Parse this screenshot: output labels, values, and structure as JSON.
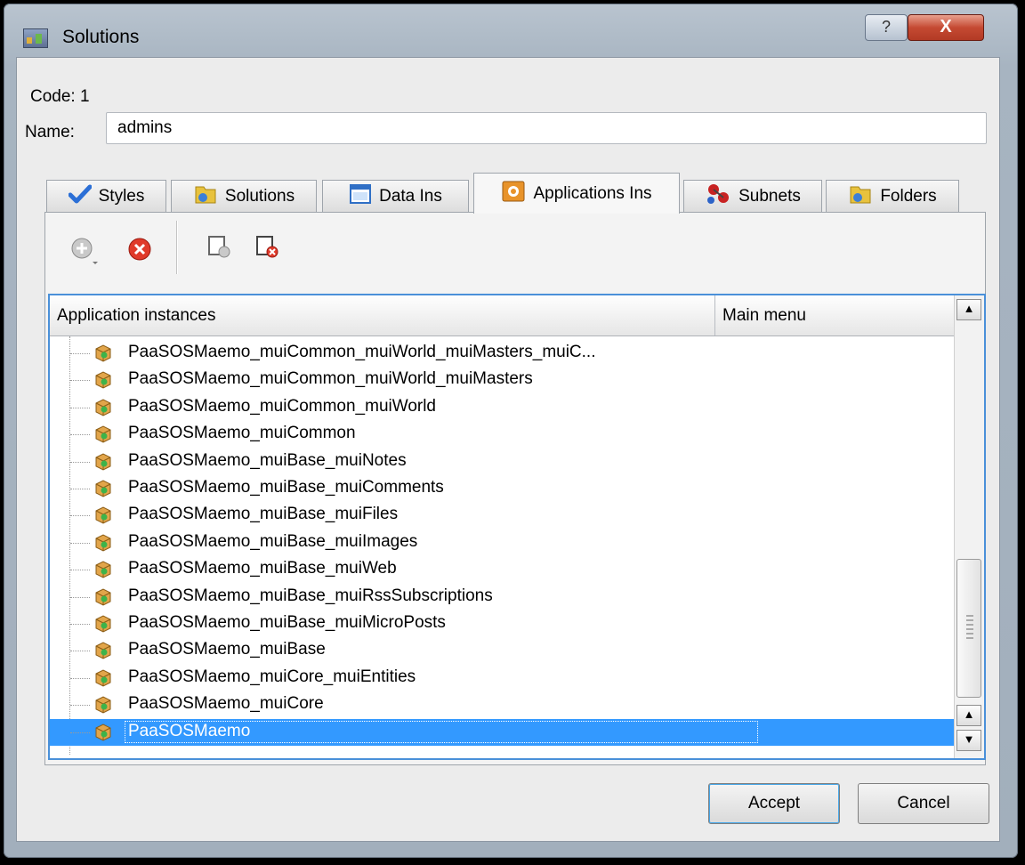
{
  "window": {
    "title": "Solutions"
  },
  "title_buttons": {
    "help": "?",
    "close": "X"
  },
  "form": {
    "code_label": "Code:",
    "code_value": "1",
    "name_label": "Name:",
    "name_value": "admins"
  },
  "tabs": [
    {
      "label": "Styles",
      "icon": "checkmark-icon"
    },
    {
      "label": "Solutions",
      "icon": "solutions-icon"
    },
    {
      "label": "Data Ins",
      "icon": "window-icon"
    },
    {
      "label": "Applications Ins",
      "icon": "gear-icon",
      "active": true
    },
    {
      "label": "Subnets",
      "icon": "molecule-icon"
    },
    {
      "label": "Folders",
      "icon": "folders-icon"
    }
  ],
  "toolbar": [
    {
      "icon": "add-icon"
    },
    {
      "icon": "delete-icon"
    },
    {
      "icon": "assign-icon"
    },
    {
      "icon": "unassign-icon"
    }
  ],
  "tree": {
    "columns": [
      "Application instances",
      "Main menu"
    ],
    "rows": [
      "PaaSOSMaemo_muiCommon_muiWorld_muiMasters_muiC...",
      "PaaSOSMaemo_muiCommon_muiWorld_muiMasters",
      "PaaSOSMaemo_muiCommon_muiWorld",
      "PaaSOSMaemo_muiCommon",
      "PaaSOSMaemo_muiBase_muiNotes",
      "PaaSOSMaemo_muiBase_muiComments",
      "PaaSOSMaemo_muiBase_muiFiles",
      "PaaSOSMaemo_muiBase_muiImages",
      "PaaSOSMaemo_muiBase_muiWeb",
      "PaaSOSMaemo_muiBase_muiRssSubscriptions",
      "PaaSOSMaemo_muiBase_muiMicroPosts",
      "PaaSOSMaemo_muiBase",
      "PaaSOSMaemo_muiCore_muiEntities",
      "PaaSOSMaemo_muiCore",
      "PaaSOSMaemo"
    ],
    "selected_index": 14
  },
  "buttons": {
    "accept": "Accept",
    "cancel": "Cancel"
  },
  "colors": {
    "selection": "#3399ff",
    "focus_border": "#4a90d9",
    "close_button": "#c54a33"
  }
}
